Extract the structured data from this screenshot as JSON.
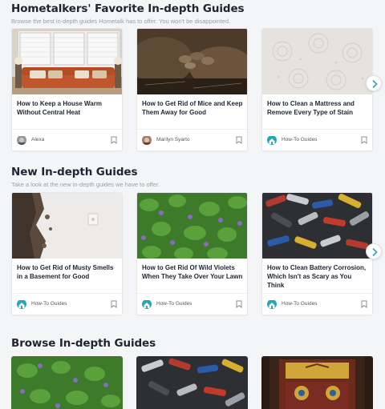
{
  "favorites": {
    "title": "Hometalkers' Favorite In-depth Guides",
    "subtitle": "Browse the best in-depth guides Hometalk has to offer. You won't be disappointed.",
    "cards": [
      {
        "title": "How to Keep a House Warm Without Central Heat",
        "author": "Alexa"
      },
      {
        "title": "How to Get Rid of Mice and Keep Them Away for Good",
        "author": "Marilyn Syarto"
      },
      {
        "title": "How to Clean a Mattress and Remove Every Type of Stain",
        "author": "How-To Guides"
      }
    ]
  },
  "new_guides": {
    "title": "New In-depth Guides",
    "subtitle": "Take a look at the new in-depth guides we have to offer.",
    "cards": [
      {
        "title": "How to Get Rid of Musty Smells in a Basement for Good",
        "author": "How-To Guides"
      },
      {
        "title": "How to Get Rid Of Wild Violets When They Take Over Your Lawn",
        "author": "How-To Guides"
      },
      {
        "title": "How to Clean Battery Corrosion, Which Isn't as Scary as You Think",
        "author": "How-To Guides"
      }
    ]
  },
  "browse": {
    "title": "Browse In-depth Guides"
  },
  "colors": {
    "accent": "#2aa5b6",
    "page_bg": "#f4f5f7",
    "title_text": "#1f2530"
  },
  "icons": [
    "bookmark-icon",
    "chevron-right-icon",
    "hometalk-logo-icon"
  ]
}
